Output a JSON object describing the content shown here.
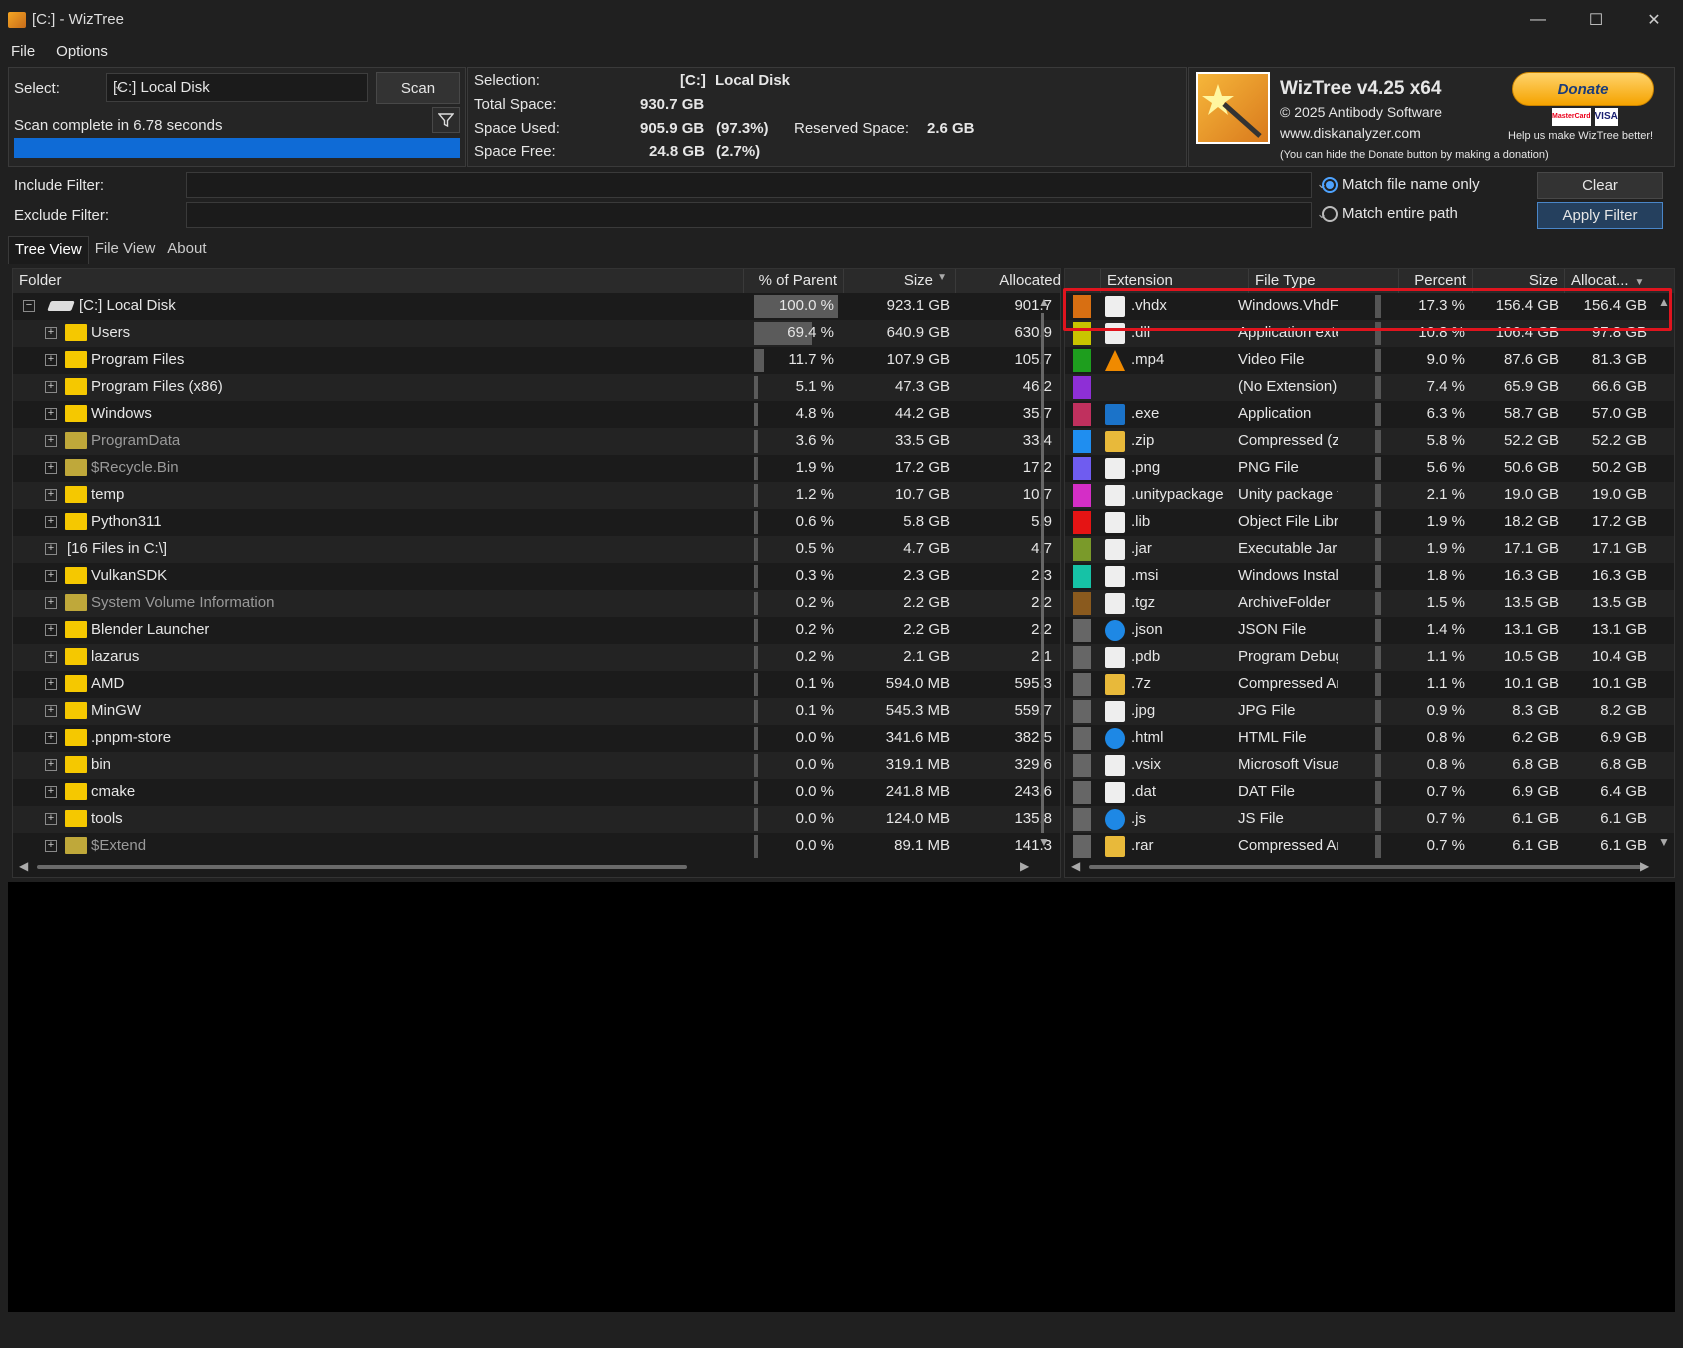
{
  "window": {
    "title": "[C:]  - WizTree",
    "minimize": "—",
    "maximize": "☐",
    "close": "✕"
  },
  "menu": [
    "File",
    "Options"
  ],
  "scan": {
    "select_label": "Select:",
    "drive": "[C:] Local Disk",
    "scan_button": "Scan",
    "status": "Scan complete in 6.78 seconds",
    "progress_percent": 100
  },
  "summary": {
    "selection_label": "Selection:",
    "selection_drive": "[C:]",
    "selection_name": "Local Disk",
    "total_label": "Total Space:",
    "total_value": "930.7 GB",
    "used_label": "Space Used:",
    "used_value": "905.9 GB",
    "used_pct": "(97.3%)",
    "reserved_label": "Reserved Space:",
    "reserved_value": "2.6 GB",
    "free_label": "Space Free:",
    "free_value": "24.8 GB",
    "free_pct": "(2.7%)"
  },
  "about": {
    "app_name": "WizTree v4.25 x64",
    "copyright": "© 2025 Antibody Software",
    "website": "www.diskanalyzer.com",
    "note": "(You can hide the Donate button by making a donation)",
    "donate_label": "Donate",
    "donate_tagline": "Help us make WizTree better!",
    "card_mc": "MasterCard",
    "card_visa": "VISA"
  },
  "filters": {
    "include_label": "Include Filter:",
    "exclude_label": "Exclude Filter:",
    "include_value": "",
    "exclude_value": "",
    "match_name_label": "Match file name only",
    "match_path_label": "Match entire path",
    "clear_button": "Clear",
    "apply_button": "Apply Filter"
  },
  "tabs": [
    "Tree View",
    "File View",
    "About"
  ],
  "tree": {
    "columns": {
      "folder": "Folder",
      "pct": "% of Parent",
      "size": "Size",
      "alloc": "Allocated"
    },
    "rows": [
      {
        "name": "[C:] Local Disk",
        "pct": "100.0 %",
        "pct_value": 100.0,
        "size": "923.1 GB",
        "alloc": "901.7",
        "root": true
      },
      {
        "name": "Users",
        "pct": "69.4 %",
        "pct_value": 69.4,
        "size": "640.9 GB",
        "alloc": "630.9"
      },
      {
        "name": "Program Files",
        "pct": "11.7 %",
        "pct_value": 11.7,
        "size": "107.9 GB",
        "alloc": "105.7"
      },
      {
        "name": "Program Files (x86)",
        "pct": "5.1 %",
        "pct_value": 5.1,
        "size": "47.3 GB",
        "alloc": "46.2"
      },
      {
        "name": "Windows",
        "pct": "4.8 %",
        "pct_value": 4.8,
        "size": "44.2 GB",
        "alloc": "35.7"
      },
      {
        "name": "ProgramData",
        "pct": "3.6 %",
        "pct_value": 3.6,
        "size": "33.5 GB",
        "alloc": "33.4",
        "dim": true
      },
      {
        "name": "$Recycle.Bin",
        "pct": "1.9 %",
        "pct_value": 1.9,
        "size": "17.2 GB",
        "alloc": "17.2",
        "dim": true,
        "sys": true
      },
      {
        "name": "temp",
        "pct": "1.2 %",
        "pct_value": 1.2,
        "size": "10.7 GB",
        "alloc": "10.7"
      },
      {
        "name": "Python311",
        "pct": "0.6 %",
        "pct_value": 0.6,
        "size": "5.8 GB",
        "alloc": "5.9"
      },
      {
        "name": "[16 Files in C:\\]",
        "pct": "0.5 %",
        "pct_value": 0.5,
        "size": "4.7 GB",
        "alloc": "4.7",
        "files": true
      },
      {
        "name": "VulkanSDK",
        "pct": "0.3 %",
        "pct_value": 0.3,
        "size": "2.3 GB",
        "alloc": "2.3"
      },
      {
        "name": "System Volume Information",
        "pct": "0.2 %",
        "pct_value": 0.2,
        "size": "2.2 GB",
        "alloc": "2.2",
        "dim": true,
        "sys": true
      },
      {
        "name": "Blender Launcher",
        "pct": "0.2 %",
        "pct_value": 0.2,
        "size": "2.2 GB",
        "alloc": "2.2"
      },
      {
        "name": "lazarus",
        "pct": "0.2 %",
        "pct_value": 0.2,
        "size": "2.1 GB",
        "alloc": "2.1"
      },
      {
        "name": "AMD",
        "pct": "0.1 %",
        "pct_value": 0.1,
        "size": "594.0 MB",
        "alloc": "595.3"
      },
      {
        "name": "MinGW",
        "pct": "0.1 %",
        "pct_value": 0.1,
        "size": "545.3 MB",
        "alloc": "559.7"
      },
      {
        "name": ".pnpm-store",
        "pct": "0.0 %",
        "pct_value": 0.0,
        "size": "341.6 MB",
        "alloc": "382.5"
      },
      {
        "name": "bin",
        "pct": "0.0 %",
        "pct_value": 0.0,
        "size": "319.1 MB",
        "alloc": "329.6"
      },
      {
        "name": "cmake",
        "pct": "0.0 %",
        "pct_value": 0.0,
        "size": "241.8 MB",
        "alloc": "243.6"
      },
      {
        "name": "tools",
        "pct": "0.0 %",
        "pct_value": 0.0,
        "size": "124.0 MB",
        "alloc": "135.8"
      },
      {
        "name": "$Extend",
        "pct": "0.0 %",
        "pct_value": 0.0,
        "size": "89.1 MB",
        "alloc": "141.3",
        "dim": true,
        "sys": true
      }
    ]
  },
  "extensions": {
    "columns": {
      "ext": "Extension",
      "type": "File Type",
      "pct": "Percent",
      "size": "Size",
      "alloc": "Allocat..."
    },
    "rows": [
      {
        "ext": ".vhdx",
        "type": "Windows.VhdFile",
        "pct": "17.3 %",
        "pct_value": 17.3,
        "size": "156.4 GB",
        "alloc": "156.4 GB",
        "color": "#d86f12",
        "icon": "file-icon"
      },
      {
        "ext": ".dll",
        "type": "Application extension",
        "pct": "10.8 %",
        "pct_value": 10.8,
        "size": "106.4 GB",
        "alloc": "97.8 GB",
        "color": "#c9c400",
        "icon": "dll-icon"
      },
      {
        "ext": ".mp4",
        "type": "Video File",
        "pct": "9.0 %",
        "pct_value": 9.0,
        "size": "87.6 GB",
        "alloc": "81.3 GB",
        "color": "#1e9e1e",
        "icon": "vlc-icon"
      },
      {
        "ext": "",
        "type": "(No Extension)",
        "pct": "7.4 %",
        "pct_value": 7.4,
        "size": "65.9 GB",
        "alloc": "66.6 GB",
        "color": "#8e2fd6",
        "icon": ""
      },
      {
        "ext": ".exe",
        "type": "Application",
        "pct": "6.3 %",
        "pct_value": 6.3,
        "size": "58.7 GB",
        "alloc": "57.0 GB",
        "color": "#c0305e",
        "icon": "exe-icon"
      },
      {
        "ext": ".zip",
        "type": "Compressed (zipped)",
        "pct": "5.8 %",
        "pct_value": 5.8,
        "size": "52.2 GB",
        "alloc": "52.2 GB",
        "color": "#1f8ef0",
        "icon": "zip-folder-icon"
      },
      {
        "ext": ".png",
        "type": "PNG File",
        "pct": "5.6 %",
        "pct_value": 5.6,
        "size": "50.6 GB",
        "alloc": "50.2 GB",
        "color": "#6f5cf0",
        "icon": "image-icon"
      },
      {
        "ext": ".unitypackage",
        "type": "Unity package file",
        "pct": "2.1 %",
        "pct_value": 2.1,
        "size": "19.0 GB",
        "alloc": "19.0 GB",
        "color": "#d42ec6",
        "icon": "unity-icon"
      },
      {
        "ext": ".lib",
        "type": "Object File Library",
        "pct": "1.9 %",
        "pct_value": 1.9,
        "size": "18.2 GB",
        "alloc": "17.2 GB",
        "color": "#e51414",
        "icon": "lib-icon"
      },
      {
        "ext": ".jar",
        "type": "Executable Jar File",
        "pct": "1.9 %",
        "pct_value": 1.9,
        "size": "17.1 GB",
        "alloc": "17.1 GB",
        "color": "#7a9a2a",
        "icon": "jar-icon"
      },
      {
        "ext": ".msi",
        "type": "Windows Installer",
        "pct": "1.8 %",
        "pct_value": 1.8,
        "size": "16.3 GB",
        "alloc": "16.3 GB",
        "color": "#16c2a6",
        "icon": "msi-icon"
      },
      {
        "ext": ".tgz",
        "type": "ArchiveFolder",
        "pct": "1.5 %",
        "pct_value": 1.5,
        "size": "13.5 GB",
        "alloc": "13.5 GB",
        "color": "#8a5a1e",
        "icon": "file-icon"
      },
      {
        "ext": ".json",
        "type": "JSON File",
        "pct": "1.4 %",
        "pct_value": 1.4,
        "size": "13.1 GB",
        "alloc": "13.1 GB",
        "color": "#666666",
        "icon": "globe-icon"
      },
      {
        "ext": ".pdb",
        "type": "Program Debug Database",
        "pct": "1.1 %",
        "pct_value": 1.1,
        "size": "10.5 GB",
        "alloc": "10.4 GB",
        "color": "#666666",
        "icon": "pdb-icon"
      },
      {
        "ext": ".7z",
        "type": "Compressed Archive",
        "pct": "1.1 %",
        "pct_value": 1.1,
        "size": "10.1 GB",
        "alloc": "10.1 GB",
        "color": "#666666",
        "icon": "zip-folder-icon"
      },
      {
        "ext": ".jpg",
        "type": "JPG File",
        "pct": "0.9 %",
        "pct_value": 0.9,
        "size": "8.3 GB",
        "alloc": "8.2 GB",
        "color": "#666666",
        "icon": "image-icon"
      },
      {
        "ext": ".html",
        "type": "HTML File",
        "pct": "0.8 %",
        "pct_value": 0.8,
        "size": "6.2 GB",
        "alloc": "6.9 GB",
        "color": "#666666",
        "icon": "globe-icon"
      },
      {
        "ext": ".vsix",
        "type": "Microsoft Visual Studio Extension",
        "pct": "0.8 %",
        "pct_value": 0.8,
        "size": "6.8 GB",
        "alloc": "6.8 GB",
        "color": "#666666",
        "icon": "vsix-icon"
      },
      {
        "ext": ".dat",
        "type": "DAT File",
        "pct": "0.7 %",
        "pct_value": 0.7,
        "size": "6.9 GB",
        "alloc": "6.4 GB",
        "color": "#666666",
        "icon": "file-icon"
      },
      {
        "ext": ".js",
        "type": "JS File",
        "pct": "0.7 %",
        "pct_value": 0.7,
        "size": "6.1 GB",
        "alloc": "6.1 GB",
        "color": "#666666",
        "icon": "globe-icon"
      },
      {
        "ext": ".rar",
        "type": "Compressed Archive",
        "pct": "0.7 %",
        "pct_value": 0.7,
        "size": "6.1 GB",
        "alloc": "6.1 GB",
        "color": "#666666",
        "icon": "zip-folder-icon"
      }
    ]
  }
}
